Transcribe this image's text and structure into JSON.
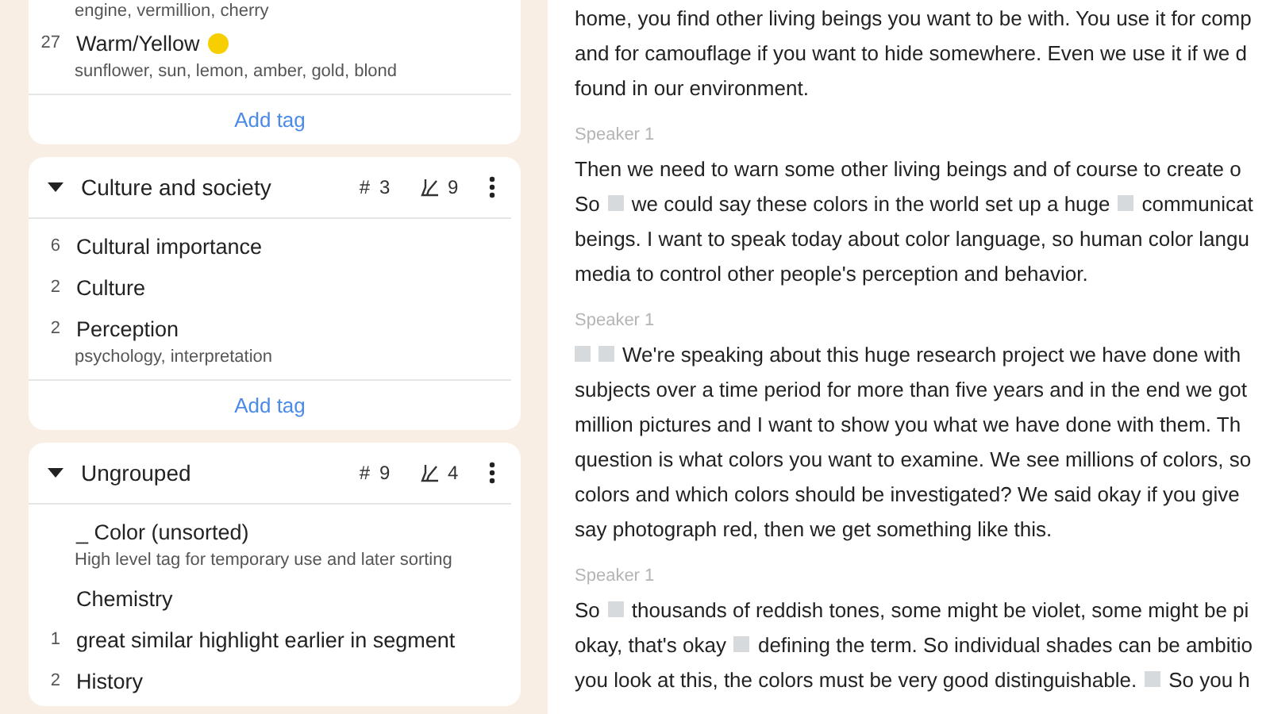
{
  "tag_groups": [
    {
      "items": [
        {
          "description": "engine, vermillion, cherry"
        },
        {
          "count": "27",
          "name": "Warm/Yellow",
          "color": "#f7cf00",
          "description": "sunflower, sun, lemon, amber, gold, blond"
        }
      ],
      "add_label": "Add tag"
    },
    {
      "title": "Culture and society",
      "expanded": true,
      "tag_symbol": "#",
      "tag_count": "3",
      "highlight_count": "9",
      "items": [
        {
          "count": "6",
          "name": "Cultural importance"
        },
        {
          "count": "2",
          "name": "Culture"
        },
        {
          "count": "2",
          "name": "Perception",
          "description": "psychology, interpretation"
        }
      ],
      "add_label": "Add tag"
    },
    {
      "title": "Ungrouped",
      "expanded": true,
      "tag_symbol": "#",
      "tag_count": "9",
      "highlight_count": "4",
      "items": [
        {
          "name": "_ Color (unsorted)",
          "description": "High level tag for temporary use and later sorting"
        },
        {
          "name": "Chemistry"
        },
        {
          "count": "1",
          "name": "great similar highlight earlier in segment"
        },
        {
          "count": "2",
          "name": "History"
        }
      ]
    }
  ],
  "transcript": [
    {
      "lines": [
        [
          {
            "kind": "text",
            "text": "home, you find other living beings you want to be with. You use it for comp"
          }
        ],
        [
          {
            "kind": "text",
            "text": "and for camouflage if you want to hide somewhere. Even we use it if we d"
          }
        ],
        [
          {
            "kind": "text",
            "text": "found in our environment."
          }
        ]
      ]
    },
    {
      "speaker": "Speaker 1",
      "lines": [
        [
          {
            "kind": "text",
            "text": "Then we need to warn some other living beings and of course to create o"
          }
        ],
        [
          {
            "kind": "text",
            "text": "So"
          },
          {
            "kind": "marker"
          },
          {
            "kind": "text",
            "text": "we could say these colors in the world set up a huge"
          },
          {
            "kind": "marker"
          },
          {
            "kind": "text",
            "text": "communicat"
          }
        ],
        [
          {
            "kind": "text",
            "text": "beings. I want to speak today about color language, so human color langu"
          }
        ],
        [
          {
            "kind": "text",
            "text": "media to control other people's perception and behavior."
          }
        ]
      ]
    },
    {
      "speaker": "Speaker 1",
      "lines": [
        [
          {
            "kind": "marker"
          },
          {
            "kind": "marker"
          },
          {
            "kind": "text",
            "text": "We're speaking about this huge research project we have done with"
          }
        ],
        [
          {
            "kind": "text",
            "text": "subjects over a time period for more than five years and in the end we got"
          }
        ],
        [
          {
            "kind": "text",
            "text": "million pictures and I want to show you what we have done with them. Th"
          }
        ],
        [
          {
            "kind": "text",
            "text": "question is what colors you want to examine. We see millions of colors, so"
          }
        ],
        [
          {
            "kind": "text",
            "text": "colors and which colors should be investigated? We said okay if you give"
          }
        ],
        [
          {
            "kind": "text",
            "text": "say photograph red, then we get something like this."
          }
        ]
      ]
    },
    {
      "speaker": "Speaker 1",
      "lines": [
        [
          {
            "kind": "text",
            "text": "So"
          },
          {
            "kind": "marker"
          },
          {
            "kind": "text",
            "text": "thousands of reddish tones, some might be violet, some might be pi"
          }
        ],
        [
          {
            "kind": "text",
            "text": "okay, that's okay"
          },
          {
            "kind": "marker"
          },
          {
            "kind": "text",
            "text": "defining the term. So individual shades can be ambitio"
          }
        ],
        [
          {
            "kind": "text",
            "text": "you look at this, the colors must be very good distinguishable."
          },
          {
            "kind": "marker"
          },
          {
            "kind": "text",
            "text": "So you h"
          }
        ]
      ]
    }
  ]
}
